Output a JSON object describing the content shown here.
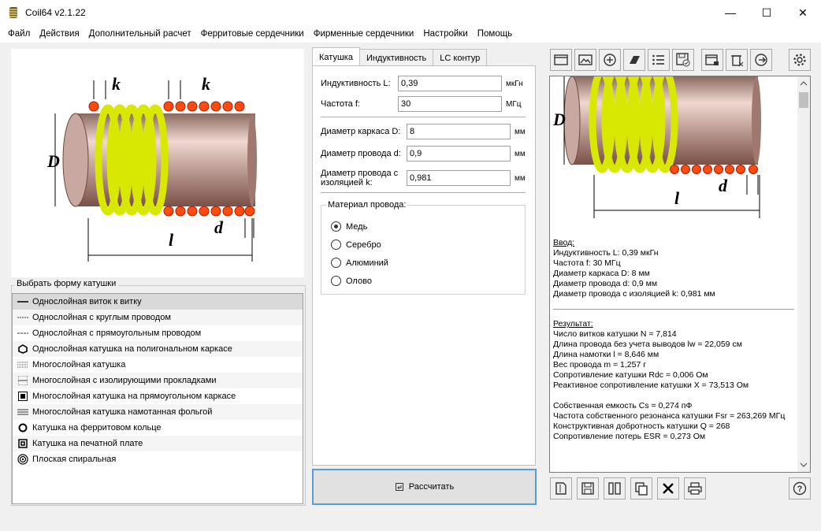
{
  "window": {
    "title": "Coil64 v2.1.22",
    "minimize_glyph": "—",
    "maximize_glyph": "☐",
    "close_glyph": "✕"
  },
  "menu": [
    "Файл",
    "Действия",
    "Дополнительный расчет",
    "Ферритовые сердечники",
    "Фирменные сердечники",
    "Настройки",
    "Помощь"
  ],
  "left_drawing": {
    "labels": {
      "k1": "k",
      "k2": "k",
      "D": "D",
      "d": "d",
      "l": "l"
    },
    "colors": {
      "coil": "#e8f000",
      "wire": "#ff4a10",
      "former": "#b38a80"
    }
  },
  "shapes": {
    "group_label": "Выбрать форму катушки",
    "items": [
      {
        "label": "Однослойная виток к витку",
        "icon": "single-layer-close-icon"
      },
      {
        "label": "Однослойная с круглым проводом",
        "icon": "single-layer-round-icon"
      },
      {
        "label": "Однослойная с прямоугольным проводом",
        "icon": "single-layer-rect-icon"
      },
      {
        "label": "Однослойная катушка на полигональном каркасе",
        "icon": "polygon-icon"
      },
      {
        "label": "Многослойная катушка",
        "icon": "multilayer-icon"
      },
      {
        "label": "Многослойная с изолирующими прокладками",
        "icon": "multilayer-gap-icon"
      },
      {
        "label": "Многослойная катушка на прямоугольном каркасе",
        "icon": "multilayer-rect-icon"
      },
      {
        "label": "Многослойная катушка намотанная фольгой",
        "icon": "foil-icon"
      },
      {
        "label": "Катушка на ферритовом кольце",
        "icon": "ferrite-ring-icon"
      },
      {
        "label": "Катушка на печатной плате",
        "icon": "pcb-coil-icon"
      },
      {
        "label": "Плоская спиральная",
        "icon": "flat-spiral-icon"
      }
    ]
  },
  "tabs": [
    "Катушка",
    "Индуктивность",
    "LC контур"
  ],
  "form": {
    "inductance": {
      "label": "Индуктивность L:",
      "value": "0,39",
      "unit": "мкГн"
    },
    "frequency": {
      "label": "Частота f:",
      "value": "30",
      "unit": "МГц"
    },
    "former_d": {
      "label": "Диаметр каркаса D:",
      "value": "8",
      "unit": "мм"
    },
    "wire_d": {
      "label": "Диаметр провода d:",
      "value": "0,9",
      "unit": "мм"
    },
    "wire_ins": {
      "label1": "Диаметр провода с",
      "label2": "изоляцией k:",
      "value": "0,981",
      "unit": "мм"
    }
  },
  "material": {
    "label": "Материал провода:",
    "options": [
      "Медь",
      "Серебро",
      "Алюминий",
      "Олово"
    ],
    "selected": "Медь"
  },
  "calc_button": "Рассчитать",
  "result_drawing": {
    "labels": {
      "D": "D",
      "d": "d",
      "l": "l"
    }
  },
  "result": {
    "input_header": "Ввод:",
    "input_lines": [
      "Индуктивность L: 0,39 мкГн",
      "Частота f: 30 МГц",
      "Диаметр каркаса D: 8 мм",
      "Диаметр провода d: 0,9 мм",
      "Диаметр провода с изоляцией k: 0,981 мм"
    ],
    "result_header": "Результат:",
    "result_lines": [
      "Число витков катушки N = 7,814",
      "Длина провода без учета выводов lw = 22,059 см",
      "Длина намотки l = 8,646 мм",
      "Вес провода m = 1,257 г",
      "Сопротивление катушки Rdc = 0,006 Ом",
      "Реактивное сопротивление катушки X = 73,513 Ом"
    ],
    "result_lines2": [
      "Собственная емкость Cs = 0,274 пФ",
      "Частота собственного резонанса катушки Fsr = 263,269 МГц",
      "Конструктивная добротность катушки Q = 268",
      "Сопротивление потерь ESR = 0,273 Ом"
    ]
  }
}
